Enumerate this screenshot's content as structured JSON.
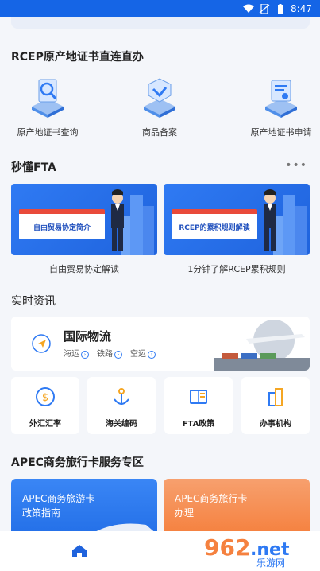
{
  "status_bar": {
    "time": "8:47"
  },
  "sections": {
    "rcep_title": "RCEP原产地证书直连直办",
    "fta_title": "秒懂FTA",
    "news_title": "实时资讯",
    "apec_title": "APEC商务旅行卡服务专区"
  },
  "cert_items": [
    {
      "label": "原产地证书查询",
      "icon": "search-document-icon"
    },
    {
      "label": "商品备案",
      "icon": "check-badge-icon"
    },
    {
      "label": "原产地证书申请",
      "icon": "certificate-icon"
    }
  ],
  "more_label": "•••",
  "videos": [
    {
      "sign_text": "自由贸易协定简介",
      "caption": "自由贸易协定解读"
    },
    {
      "sign_text": "RCEP的累积规则解读",
      "caption": "1分钟了解RCEP累积规则"
    }
  ],
  "logistics": {
    "title": "国际物流",
    "links": [
      "海运",
      "铁路",
      "空运"
    ]
  },
  "tiles": [
    {
      "label": "外汇汇率",
      "icon": "currency-exchange-icon"
    },
    {
      "label": "海关编码",
      "icon": "anchor-icon"
    },
    {
      "label": "FTA政策",
      "icon": "policy-book-icon"
    },
    {
      "label": "办事机构",
      "icon": "building-icon"
    }
  ],
  "apec_cards": [
    {
      "line1": "APEC商务旅游卡",
      "line2": "政策指南"
    },
    {
      "line1": "APEC商务旅行卡",
      "line2": "办理"
    }
  ],
  "watermark": {
    "digits": "962",
    "suffix": ".net",
    "text": "乐游网"
  },
  "colors": {
    "accent": "#2f7af3",
    "status_bar": "#1565e6",
    "orange": "#f5813f"
  }
}
